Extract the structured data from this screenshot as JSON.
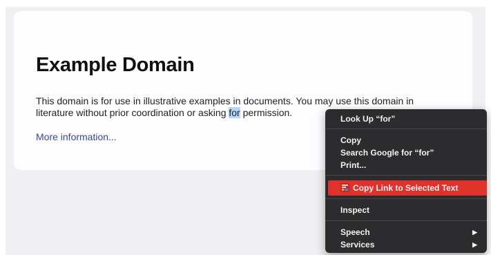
{
  "page": {
    "title": "Example Domain",
    "paragraph_before": "This domain is for use in illustrative examples in documents. You may use this domain in literature without prior coordination or asking ",
    "selected_word": "for",
    "paragraph_after": " permission.",
    "link_text": "More information..."
  },
  "context_menu": {
    "look_up": "Look Up “for”",
    "copy": "Copy",
    "search_google": "Search Google for “for”",
    "print": "Print...",
    "copy_link": "Copy Link to Selected Text",
    "inspect": "Inspect",
    "speech": "Speech",
    "services": "Services",
    "highlight_color": "#e0312c",
    "extension_icon": "copy-link-extension-icon",
    "submenu_icon": "chevron-right-icon"
  },
  "colors": {
    "background": "#f0f0f2",
    "card": "#fdfdff",
    "link": "#38488f",
    "selection": "#b5d5fb",
    "menu_background": "#2c2c2e"
  }
}
